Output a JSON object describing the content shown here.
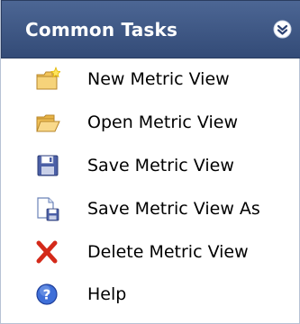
{
  "panel": {
    "title": "Common Tasks",
    "collapse_icon": "double-chevron-up-icon",
    "header_color": "#3d5583"
  },
  "tasks": [
    {
      "label": "New Metric View",
      "icon": "new-folder-star-icon"
    },
    {
      "label": "Open Metric View",
      "icon": "open-folder-icon"
    },
    {
      "label": "Save Metric View",
      "icon": "floppy-disk-icon"
    },
    {
      "label": "Save Metric View As",
      "icon": "save-as-document-icon"
    },
    {
      "label": "Delete Metric View",
      "icon": "red-x-delete-icon"
    },
    {
      "label": "Help",
      "icon": "help-question-icon"
    }
  ]
}
